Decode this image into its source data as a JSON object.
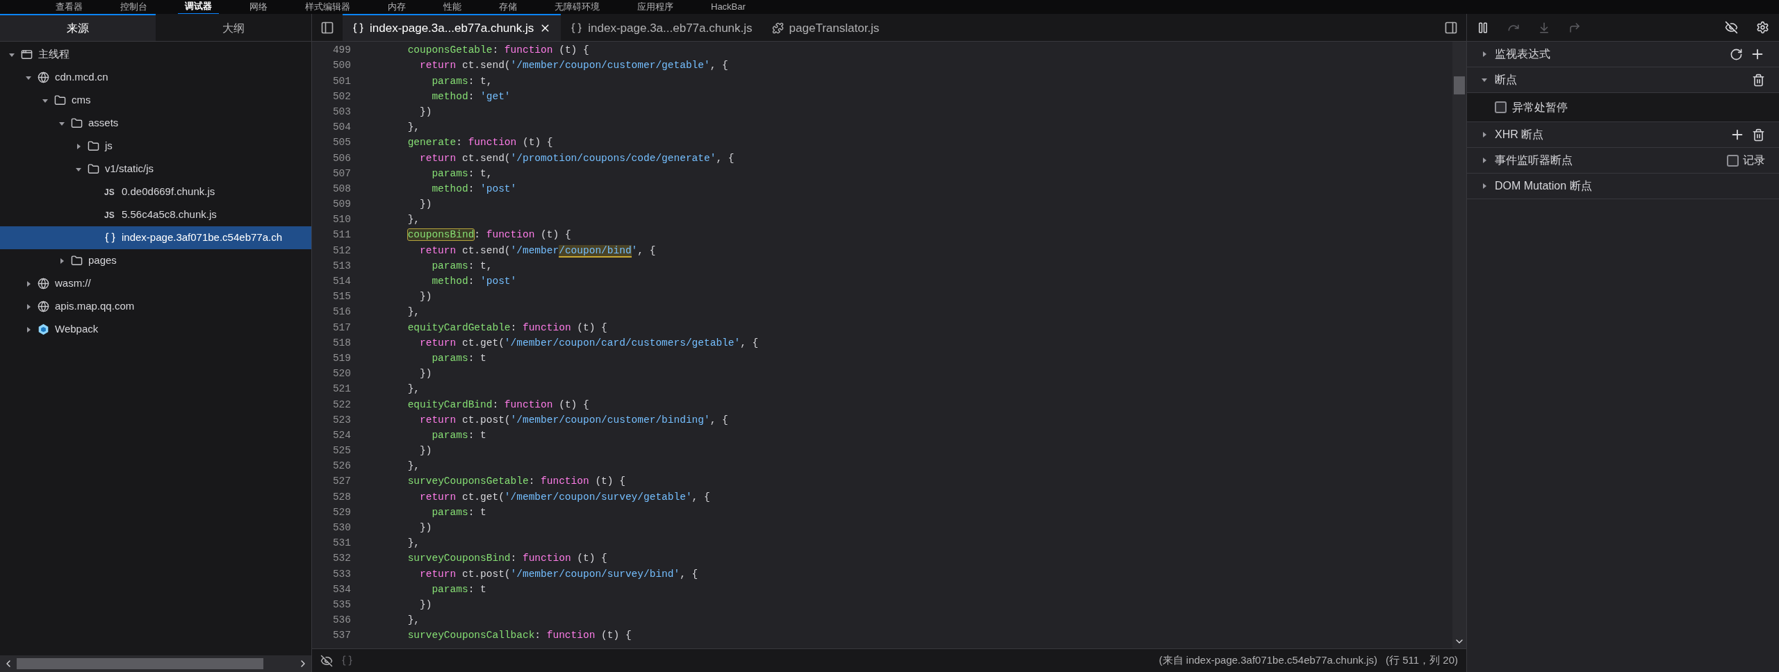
{
  "toolbox_tabs": [
    {
      "label": "查看器",
      "selected": false
    },
    {
      "label": "控制台",
      "selected": false
    },
    {
      "label": "调试器",
      "selected": true
    },
    {
      "label": "网络",
      "selected": false
    },
    {
      "label": "样式编辑器",
      "selected": false
    },
    {
      "label": "内存",
      "selected": false
    },
    {
      "label": "性能",
      "selected": false
    },
    {
      "label": "存储",
      "selected": false
    },
    {
      "label": "无障碍环境",
      "selected": false
    },
    {
      "label": "应用程序",
      "selected": false
    },
    {
      "label": "HackBar",
      "selected": false
    }
  ],
  "sources_panel": {
    "tabs": [
      {
        "label": "来源",
        "selected": true
      },
      {
        "label": "大纲",
        "selected": false
      }
    ],
    "tree": [
      {
        "kind": "thread",
        "label": "主线程",
        "expanded": true,
        "selected": false,
        "children": [
          {
            "kind": "domain",
            "label": "cdn.mcd.cn",
            "expanded": true,
            "selected": false,
            "children": [
              {
                "kind": "folder",
                "label": "cms",
                "expanded": true,
                "selected": false,
                "children": [
                  {
                    "kind": "folder",
                    "label": "assets",
                    "expanded": true,
                    "selected": false,
                    "children": [
                      {
                        "kind": "folder",
                        "label": "js",
                        "expanded": false,
                        "selected": false
                      },
                      {
                        "kind": "folder",
                        "label": "v1/static/js",
                        "expanded": true,
                        "selected": false,
                        "children": [
                          {
                            "kind": "js",
                            "badge": "JS",
                            "label": "0.de0d669f.chunk.js",
                            "selected": false
                          },
                          {
                            "kind": "js",
                            "badge": "JS",
                            "label": "5.56c4a5c8.chunk.js",
                            "selected": false
                          },
                          {
                            "kind": "pretty",
                            "label": "index-page.3af071be.c54eb77a.ch",
                            "selected": true
                          }
                        ]
                      }
                    ]
                  },
                  {
                    "kind": "folder",
                    "label": "pages",
                    "expanded": false,
                    "selected": false
                  }
                ]
              }
            ]
          },
          {
            "kind": "domain",
            "label": "wasm://",
            "expanded": false,
            "selected": false
          },
          {
            "kind": "domain",
            "label": "apis.map.qq.com",
            "expanded": false,
            "selected": false
          },
          {
            "kind": "webpack",
            "label": "Webpack",
            "expanded": false,
            "selected": false
          }
        ]
      }
    ]
  },
  "editor": {
    "tabs": [
      {
        "kind": "pretty",
        "label": "index-page.3a...eb77a.chunk.js",
        "selected": true,
        "closable": true
      },
      {
        "kind": "pretty",
        "label": "index-page.3a...eb77a.chunk.js",
        "selected": false,
        "closable": false
      },
      {
        "kind": "extension",
        "label": "pageTranslator.js",
        "selected": false,
        "closable": false
      }
    ],
    "lines": [
      {
        "number": "499",
        "tokens": [
          {
            "kind": "prop",
            "text": "        couponsGetable"
          },
          {
            "kind": "plain",
            "text": ": "
          },
          {
            "kind": "kw",
            "text": "function"
          },
          {
            "kind": "plain",
            "text": " (t) {"
          }
        ]
      },
      {
        "number": "500",
        "tokens": [
          {
            "kind": "kw",
            "text": "          return"
          },
          {
            "kind": "plain",
            "text": " ct.send("
          },
          {
            "kind": "str",
            "text": "'/member/coupon/customer/getable'"
          },
          {
            "kind": "plain",
            "text": ", {"
          }
        ]
      },
      {
        "number": "501",
        "tokens": [
          {
            "kind": "prop",
            "text": "            params"
          },
          {
            "kind": "plain",
            "text": ": t,"
          }
        ]
      },
      {
        "number": "502",
        "tokens": [
          {
            "kind": "prop",
            "text": "            method"
          },
          {
            "kind": "plain",
            "text": ": "
          },
          {
            "kind": "str",
            "text": "'get'"
          }
        ]
      },
      {
        "number": "503",
        "tokens": [
          {
            "kind": "plain",
            "text": "          })"
          }
        ]
      },
      {
        "number": "504",
        "tokens": [
          {
            "kind": "plain",
            "text": "        },"
          }
        ]
      },
      {
        "number": "505",
        "tokens": [
          {
            "kind": "prop",
            "text": "        generate"
          },
          {
            "kind": "plain",
            "text": ": "
          },
          {
            "kind": "kw",
            "text": "function"
          },
          {
            "kind": "plain",
            "text": " (t) {"
          }
        ]
      },
      {
        "number": "506",
        "tokens": [
          {
            "kind": "kw",
            "text": "          return"
          },
          {
            "kind": "plain",
            "text": " ct.send("
          },
          {
            "kind": "str",
            "text": "'/promotion/coupons/code/generate'"
          },
          {
            "kind": "plain",
            "text": ", {"
          }
        ]
      },
      {
        "number": "507",
        "tokens": [
          {
            "kind": "prop",
            "text": "            params"
          },
          {
            "kind": "plain",
            "text": ": t,"
          }
        ]
      },
      {
        "number": "508",
        "tokens": [
          {
            "kind": "prop",
            "text": "            method"
          },
          {
            "kind": "plain",
            "text": ": "
          },
          {
            "kind": "str",
            "text": "'post'"
          }
        ]
      },
      {
        "number": "509",
        "tokens": [
          {
            "kind": "plain",
            "text": "          })"
          }
        ]
      },
      {
        "number": "510",
        "tokens": [
          {
            "kind": "plain",
            "text": "        },"
          }
        ]
      },
      {
        "number": "511",
        "tokens": [
          {
            "kind": "prop",
            "text": "        couponsBind",
            "search_match": true
          },
          {
            "kind": "plain",
            "text": ": "
          },
          {
            "kind": "kw",
            "text": "function"
          },
          {
            "kind": "plain",
            "text": " (t) {"
          }
        ]
      },
      {
        "number": "512",
        "tokens": [
          {
            "kind": "kw",
            "text": "          return"
          },
          {
            "kind": "plain",
            "text": " ct.send("
          },
          {
            "kind": "str",
            "text": "'/member"
          },
          {
            "kind": "str",
            "text": "/coupon/bind",
            "selected": true
          },
          {
            "kind": "str",
            "text": "'"
          },
          {
            "kind": "plain",
            "text": ", {"
          }
        ]
      },
      {
        "number": "513",
        "tokens": [
          {
            "kind": "prop",
            "text": "            params"
          },
          {
            "kind": "plain",
            "text": ": t,"
          }
        ]
      },
      {
        "number": "514",
        "tokens": [
          {
            "kind": "prop",
            "text": "            method"
          },
          {
            "kind": "plain",
            "text": ": "
          },
          {
            "kind": "str",
            "text": "'post'"
          }
        ]
      },
      {
        "number": "515",
        "tokens": [
          {
            "kind": "plain",
            "text": "          })"
          }
        ]
      },
      {
        "number": "516",
        "tokens": [
          {
            "kind": "plain",
            "text": "        },"
          }
        ]
      },
      {
        "number": "517",
        "tokens": [
          {
            "kind": "prop",
            "text": "        equityCardGetable"
          },
          {
            "kind": "plain",
            "text": ": "
          },
          {
            "kind": "kw",
            "text": "function"
          },
          {
            "kind": "plain",
            "text": " (t) {"
          }
        ]
      },
      {
        "number": "518",
        "tokens": [
          {
            "kind": "kw",
            "text": "          return"
          },
          {
            "kind": "plain",
            "text": " ct.get("
          },
          {
            "kind": "str",
            "text": "'/member/coupon/card/customers/getable'"
          },
          {
            "kind": "plain",
            "text": ", {"
          }
        ]
      },
      {
        "number": "519",
        "tokens": [
          {
            "kind": "prop",
            "text": "            params"
          },
          {
            "kind": "plain",
            "text": ": t"
          }
        ]
      },
      {
        "number": "520",
        "tokens": [
          {
            "kind": "plain",
            "text": "          })"
          }
        ]
      },
      {
        "number": "521",
        "tokens": [
          {
            "kind": "plain",
            "text": "        },"
          }
        ]
      },
      {
        "number": "522",
        "tokens": [
          {
            "kind": "prop",
            "text": "        equityCardBind"
          },
          {
            "kind": "plain",
            "text": ": "
          },
          {
            "kind": "kw",
            "text": "function"
          },
          {
            "kind": "plain",
            "text": " (t) {"
          }
        ]
      },
      {
        "number": "523",
        "tokens": [
          {
            "kind": "kw",
            "text": "          return"
          },
          {
            "kind": "plain",
            "text": " ct.post("
          },
          {
            "kind": "str",
            "text": "'/member/coupon/customer/binding'"
          },
          {
            "kind": "plain",
            "text": ", {"
          }
        ]
      },
      {
        "number": "524",
        "tokens": [
          {
            "kind": "prop",
            "text": "            params"
          },
          {
            "kind": "plain",
            "text": ": t"
          }
        ]
      },
      {
        "number": "525",
        "tokens": [
          {
            "kind": "plain",
            "text": "          })"
          }
        ]
      },
      {
        "number": "526",
        "tokens": [
          {
            "kind": "plain",
            "text": "        },"
          }
        ]
      },
      {
        "number": "527",
        "tokens": [
          {
            "kind": "prop",
            "text": "        surveyCouponsGetable"
          },
          {
            "kind": "plain",
            "text": ": "
          },
          {
            "kind": "kw",
            "text": "function"
          },
          {
            "kind": "plain",
            "text": " (t) {"
          }
        ]
      },
      {
        "number": "528",
        "tokens": [
          {
            "kind": "kw",
            "text": "          return"
          },
          {
            "kind": "plain",
            "text": " ct.get("
          },
          {
            "kind": "str",
            "text": "'/member/coupon/survey/getable'"
          },
          {
            "kind": "plain",
            "text": ", {"
          }
        ]
      },
      {
        "number": "529",
        "tokens": [
          {
            "kind": "prop",
            "text": "            params"
          },
          {
            "kind": "plain",
            "text": ": t"
          }
        ]
      },
      {
        "number": "530",
        "tokens": [
          {
            "kind": "plain",
            "text": "          })"
          }
        ]
      },
      {
        "number": "531",
        "tokens": [
          {
            "kind": "plain",
            "text": "        },"
          }
        ]
      },
      {
        "number": "532",
        "tokens": [
          {
            "kind": "prop",
            "text": "        surveyCouponsBind"
          },
          {
            "kind": "plain",
            "text": ": "
          },
          {
            "kind": "kw",
            "text": "function"
          },
          {
            "kind": "plain",
            "text": " (t) {"
          }
        ]
      },
      {
        "number": "533",
        "tokens": [
          {
            "kind": "kw",
            "text": "          return"
          },
          {
            "kind": "plain",
            "text": " ct.post("
          },
          {
            "kind": "str",
            "text": "'/member/coupon/survey/bind'"
          },
          {
            "kind": "plain",
            "text": ", {"
          }
        ]
      },
      {
        "number": "534",
        "tokens": [
          {
            "kind": "prop",
            "text": "            params"
          },
          {
            "kind": "plain",
            "text": ": t"
          }
        ]
      },
      {
        "number": "535",
        "tokens": [
          {
            "kind": "plain",
            "text": "          })"
          }
        ]
      },
      {
        "number": "536",
        "tokens": [
          {
            "kind": "plain",
            "text": "        },"
          }
        ]
      },
      {
        "number": "537",
        "tokens": [
          {
            "kind": "prop",
            "text": "        surveyCouponsCallback"
          },
          {
            "kind": "plain",
            "text": ": "
          },
          {
            "kind": "kw",
            "text": "function"
          },
          {
            "kind": "plain",
            "text": " (t) {"
          }
        ]
      }
    ]
  },
  "debugger_panel": {
    "controls": [
      {
        "kind": "pause",
        "disabled": false
      },
      {
        "kind": "step-over",
        "disabled": true
      },
      {
        "kind": "step-in",
        "disabled": true
      },
      {
        "kind": "step-out",
        "disabled": true
      }
    ],
    "sections": [
      {
        "title": "监视表达式",
        "expanded": false,
        "actions": [
          {
            "kind": "refresh"
          },
          {
            "kind": "add"
          }
        ]
      },
      {
        "title": "断点",
        "expanded": true,
        "actions": [
          {
            "kind": "delete"
          }
        ],
        "items": [
          {
            "label": "异常处暂停",
            "checked": false
          }
        ]
      },
      {
        "title": "XHR 断点",
        "expanded": false,
        "actions": [
          {
            "kind": "add"
          },
          {
            "kind": "delete"
          }
        ]
      },
      {
        "title": "事件监听器断点",
        "expanded": false,
        "toggle": {
          "label": "记录",
          "checked": false
        }
      },
      {
        "title": "DOM Mutation 断点",
        "expanded": false
      }
    ]
  },
  "status_bar": {
    "source": "(来自 index-page.3af071be.c54eb77a.chunk.js)",
    "position": "(行 511，列 20)"
  }
}
